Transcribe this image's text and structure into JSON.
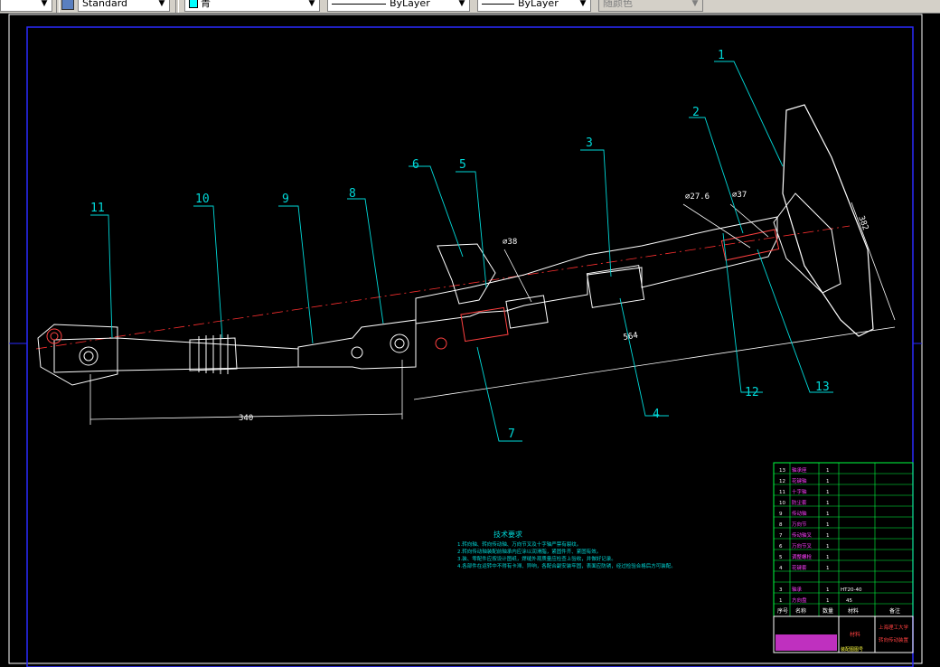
{
  "toolbar": {
    "text_style": "Standard",
    "color": "青",
    "linetype": "ByLayer",
    "lineweight": "ByLayer",
    "plot_style": "随颜色"
  },
  "callouts": [
    "1",
    "2",
    "3",
    "4",
    "5",
    "6",
    "7",
    "8",
    "9",
    "10",
    "11",
    "12",
    "13"
  ],
  "dimensions": {
    "d1": "⌀27.6",
    "d2": "⌀37",
    "d3": "⌀38",
    "len_main": "564",
    "len_bottom": "340",
    "wheel": "382"
  },
  "tech_notes": {
    "title": "技术要求",
    "lines": [
      "1.转向轴、转向传动轴、万向节叉及十字轴严禁有裂纹。",
      "2.转向传动轴装配前轴承内应涂以润滑脂，紧固件齐、紧固有效。",
      "3.装、零配件应按设计图纸，焊缝外观质量应检查上验收，并做好记录。",
      "4.各部件在运转中不得有卡滞、异响，各配合副安装牢固，表面应防锈，经过检验合格后方可装配。"
    ]
  },
  "bom": {
    "rows": [
      {
        "no": "13",
        "name": "轴承座",
        "qty": "1",
        "mat": ""
      },
      {
        "no": "12",
        "name": "花键轴",
        "qty": "1",
        "mat": ""
      },
      {
        "no": "11",
        "name": "十字轴",
        "qty": "1",
        "mat": ""
      },
      {
        "no": "10",
        "name": "防尘套",
        "qty": "1",
        "mat": ""
      },
      {
        "no": "9",
        "name": "传动轴",
        "qty": "1",
        "mat": ""
      },
      {
        "no": "8",
        "name": "万向节",
        "qty": "1",
        "mat": ""
      },
      {
        "no": "7",
        "name": "传动轴叉",
        "qty": "1",
        "mat": ""
      },
      {
        "no": "6",
        "name": "万向节叉",
        "qty": "1",
        "mat": ""
      },
      {
        "no": "5",
        "name": "调整螺栓",
        "qty": "1",
        "mat": ""
      },
      {
        "no": "4",
        "name": "花键套",
        "qty": "1",
        "mat": ""
      },
      {
        "no": "3",
        "name": "轴承",
        "qty": "1",
        "mat": "HT20-40"
      },
      {
        "no": "1",
        "name": "方向盘",
        "qty": "1",
        "mat": "45"
      }
    ],
    "header": [
      "序号",
      "名称",
      "数量",
      "材料",
      "备注"
    ],
    "school": "上海理工大学",
    "drawing_title": "转向传动装置",
    "mat_label": "材料",
    "footer": "装配图图号"
  }
}
